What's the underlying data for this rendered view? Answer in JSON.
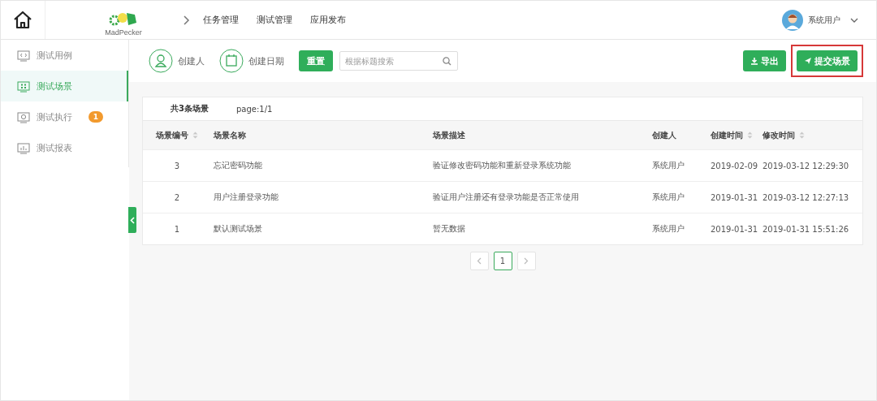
{
  "header": {
    "logo_text": "MadPecker",
    "nav": [
      "任务管理",
      "测试管理",
      "应用发布"
    ],
    "user": "系统用户"
  },
  "sidebar": {
    "items": [
      {
        "label": "测试用例",
        "kind": "code",
        "selected": false
      },
      {
        "label": "测试场景",
        "kind": "grid",
        "selected": true
      },
      {
        "label": "测试执行",
        "kind": "play",
        "selected": false,
        "badge": "1"
      },
      {
        "label": "测试报表",
        "kind": "chart",
        "selected": false
      }
    ]
  },
  "filters": {
    "creator": "创建人",
    "date": "创建日期",
    "reset": "重置",
    "search": {
      "placeholder": "根据标题搜索"
    }
  },
  "actions": [
    {
      "label": "导出",
      "kind": "download",
      "highlighted": false
    },
    {
      "label": "提交场景",
      "kind": "send",
      "highlighted": true
    }
  ],
  "summary": {
    "total": "共3条场景",
    "page": "page:1/1"
  },
  "table": {
    "columns": [
      {
        "label": "场景编号",
        "sortable": true
      },
      {
        "label": "场景名称",
        "sortable": false
      },
      {
        "label": "场景描述",
        "sortable": false
      },
      {
        "label": "创建人",
        "sortable": false
      },
      {
        "label": "创建时间",
        "sortable": true
      },
      {
        "label": "修改时间",
        "sortable": true
      }
    ],
    "rows": [
      [
        "3",
        "忘记密码功能",
        "验证修改密码功能和重新登录系统功能",
        "系统用户",
        "2019-02-09",
        "2019-03-12 12:29:30"
      ],
      [
        "2",
        "用户注册登录功能",
        "验证用户注册还有登录功能是否正常使用",
        "系统用户",
        "2019-01-31",
        "2019-03-12 12:27:13"
      ],
      [
        "1",
        "默认测试场景",
        "暂无数据",
        "系统用户",
        "2019-01-31",
        "2019-01-31 15:51:26"
      ]
    ]
  },
  "pagination": {
    "pages": [
      {
        "label": "1",
        "selected": true
      }
    ]
  }
}
